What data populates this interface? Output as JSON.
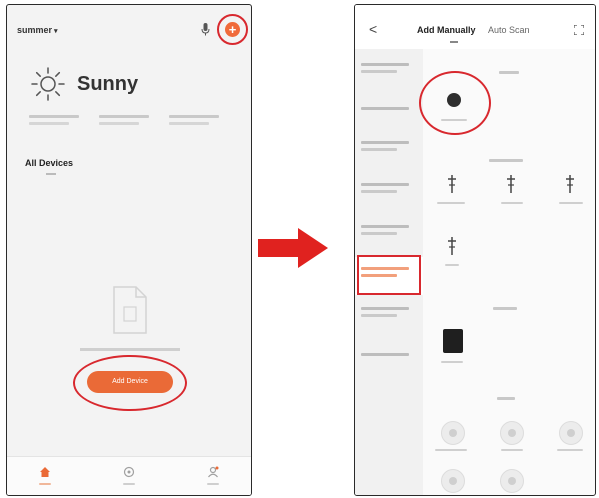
{
  "left_phone": {
    "home_name": "summer",
    "weather": {
      "condition": "Sunny"
    },
    "section": {
      "title": "All Devices"
    },
    "add_device_button": {
      "label": "Add Device"
    },
    "tabs": [
      {
        "name": "home-icon",
        "color": "#ea6a37"
      },
      {
        "name": "smart-icon",
        "color": "#a0a0a0"
      },
      {
        "name": "me-icon",
        "color": "#a0a0a0"
      }
    ]
  },
  "right_phone": {
    "header": {
      "tab_add": "Add Manually",
      "tab_auto": "Auto Scan"
    },
    "highlighted_sidebar_index": 5
  },
  "colors": {
    "accent": "#ea6a37",
    "highlight": "#d8282e"
  }
}
